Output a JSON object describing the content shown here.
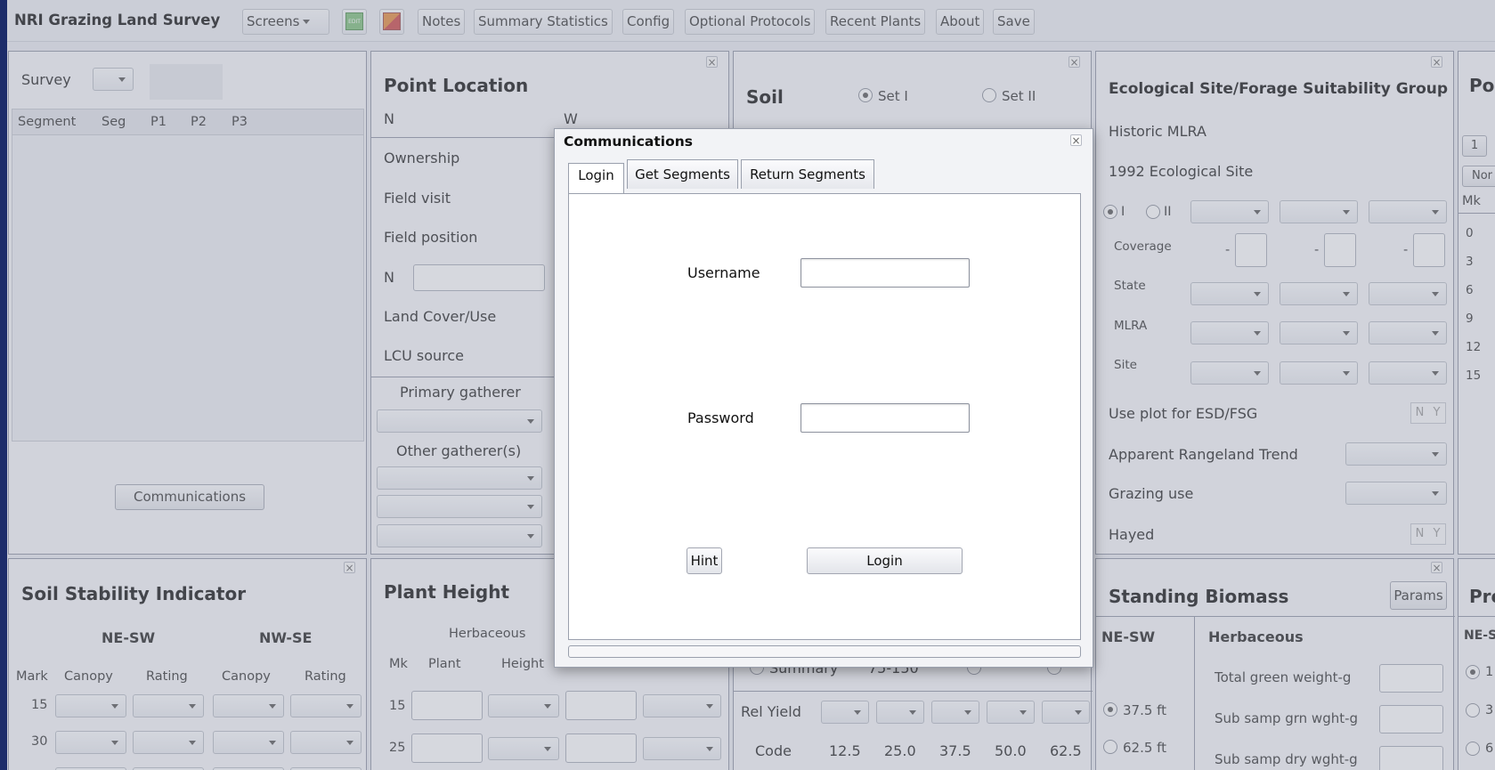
{
  "app": {
    "title": "NRI Grazing Land Survey"
  },
  "toolbar": {
    "screens": "Screens",
    "edit_icon_text": "EDIT",
    "notes": "Notes",
    "summary_statistics": "Summary Statistics",
    "config": "Config",
    "optional_protocols": "Optional Protocols",
    "recent_plants": "Recent Plants",
    "about": "About",
    "save": "Save"
  },
  "survey": {
    "label": "Survey",
    "columns": [
      "Segment",
      "Seg",
      "P1",
      "P2",
      "P3"
    ],
    "communications_button": "Communications"
  },
  "point_location": {
    "title": "Point Location",
    "n": "N",
    "w": "W",
    "ownership": "Ownership",
    "field_visit": "Field visit",
    "field_position": "Field position",
    "n_field": "N",
    "land_cover": "Land Cover/Use",
    "lcu_source": "LCU source",
    "primary_gatherer": "Primary gatherer",
    "other_gatherers": "Other gatherer(s)"
  },
  "soil": {
    "title": "Soil",
    "set1": "Set I",
    "set2": "Set II",
    "summary": "Summary",
    "summary_range": "75-150",
    "rel_yield": "Rel Yield",
    "code": "Code",
    "codes": [
      "12.5",
      "25.0",
      "37.5",
      "50.0",
      "62.5"
    ]
  },
  "ecological": {
    "title": "Ecological Site/Forage Suitability Group",
    "historic_mlra": "Historic MLRA",
    "eco_site_1992": "1992 Ecological Site",
    "opt_i": "I",
    "opt_ii": "II",
    "coverage": "Coverage",
    "state": "State",
    "mlra": "MLRA",
    "site": "Site",
    "dash": "-",
    "use_plot": "Use plot for ESD/FSG",
    "apparent_trend": "Apparent Rangeland Trend",
    "grazing_use": "Grazing use",
    "hayed": "Hayed",
    "n": "N",
    "y": "Y"
  },
  "right_panel": {
    "title": "Po",
    "btn1": "1",
    "btn_non": "Nor",
    "mk": "Mk",
    "marks": [
      "0",
      "3",
      "6",
      "9",
      "12",
      "15"
    ]
  },
  "soil_stability": {
    "title": "Soil Stability Indicator",
    "ne_sw": "NE-SW",
    "nw_se": "NW-SE",
    "mark": "Mark",
    "canopy": "Canopy",
    "rating": "Rating",
    "rows": [
      "15",
      "30"
    ]
  },
  "plant_height": {
    "title": "Plant Height",
    "herbaceous": "Herbaceous",
    "mk": "Mk",
    "plant": "Plant",
    "height": "Height",
    "rows": [
      "15",
      "25"
    ]
  },
  "standing_biomass": {
    "title": "Standing Biomass",
    "params": "Params",
    "ne_sw": "NE-SW",
    "herbaceous": "Herbaceous",
    "opt1": "37.5 ft",
    "opt2": "62.5 ft",
    "total_green": "Total green weight-g",
    "sub_grn": "Sub samp grn wght-g",
    "sub_dry": "Sub samp dry wght-g"
  },
  "far_right_bottom": {
    "title": "Pro",
    "ne": "NE-S",
    "opts": [
      "1",
      "3",
      "6"
    ]
  },
  "dialog": {
    "title": "Communications",
    "tabs": [
      "Login",
      "Get Segments",
      "Return Segments"
    ],
    "username_label": "Username",
    "password_label": "Password",
    "username_value": "",
    "password_value": "",
    "hint": "Hint",
    "login": "Login"
  }
}
